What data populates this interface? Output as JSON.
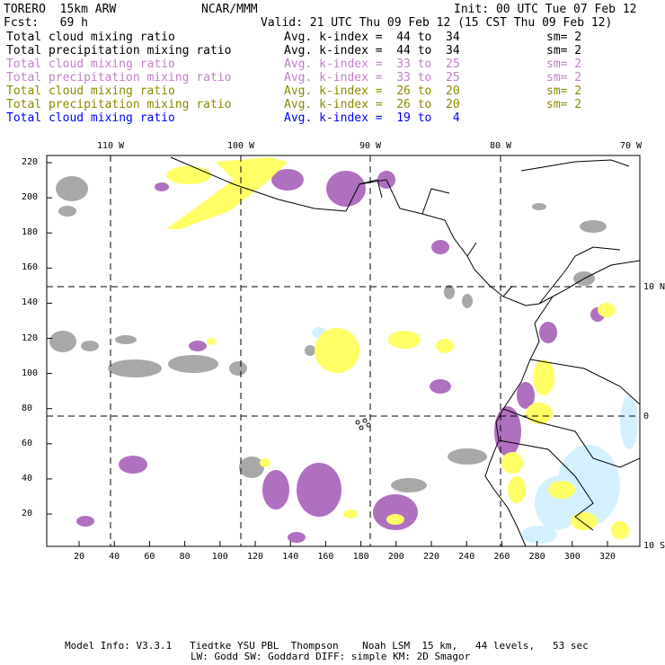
{
  "header": {
    "model": "TORERO  15km ARW",
    "org": "NCAR/MMM",
    "init": "Init: 00 UTC Tue 07 Feb 12",
    "fcst": "Fcst:   69 h",
    "valid": "Valid: 21 UTC Thu 09 Feb 12 (15 CST Thu 09 Feb 12)"
  },
  "legend": [
    {
      "field": "Total cloud mixing ratio",
      "range": "Avg. k-index =  44 to  34",
      "sm": "sm= 2",
      "color": "#000000"
    },
    {
      "field": "Total precipitation mixing ratio",
      "range": "Avg. k-index =  44 to  34",
      "sm": "sm= 2",
      "color": "#000000"
    },
    {
      "field": "Total cloud mixing ratio",
      "range": "Avg. k-index =  33 to  25",
      "sm": "sm= 2",
      "color": "#c080c8"
    },
    {
      "field": "Total precipitation mixing ratio",
      "range": "Avg. k-index =  33 to  25",
      "sm": "sm= 2",
      "color": "#c080c8"
    },
    {
      "field": "Total cloud mixing ratio",
      "range": "Avg. k-index =  26 to  20",
      "sm": "sm= 2",
      "color": "#8a8a00"
    },
    {
      "field": "Total precipitation mixing ratio",
      "range": "Avg. k-index =  26 to  20",
      "sm": "sm= 2",
      "color": "#8a8a00"
    },
    {
      "field": "Total cloud mixing ratio",
      "range": "Avg. k-index =  19 to   4",
      "sm": "",
      "color": "#0000ff"
    }
  ],
  "axes": {
    "top": [
      "110 W",
      "100 W",
      "90 W",
      "80 W",
      "70 W"
    ],
    "right": [
      "10 N",
      "0",
      "10 S"
    ],
    "left": [
      "220",
      "200",
      "180",
      "160",
      "140",
      "120",
      "100",
      "80",
      "60",
      "40",
      "20"
    ],
    "bottom": [
      "20",
      "40",
      "60",
      "80",
      "100",
      "120",
      "140",
      "160",
      "180",
      "200",
      "220",
      "240",
      "260",
      "280",
      "300",
      "320"
    ]
  },
  "footer": {
    "line1": "Model Info: V3.3.1   Tiedtke YSU PBL  Thompson    Noah LSM  15 km,   44 levels,   53 sec",
    "line2": "LW: Godd SW: Goddard DIFF: simple KM: 2D Smagor"
  }
}
